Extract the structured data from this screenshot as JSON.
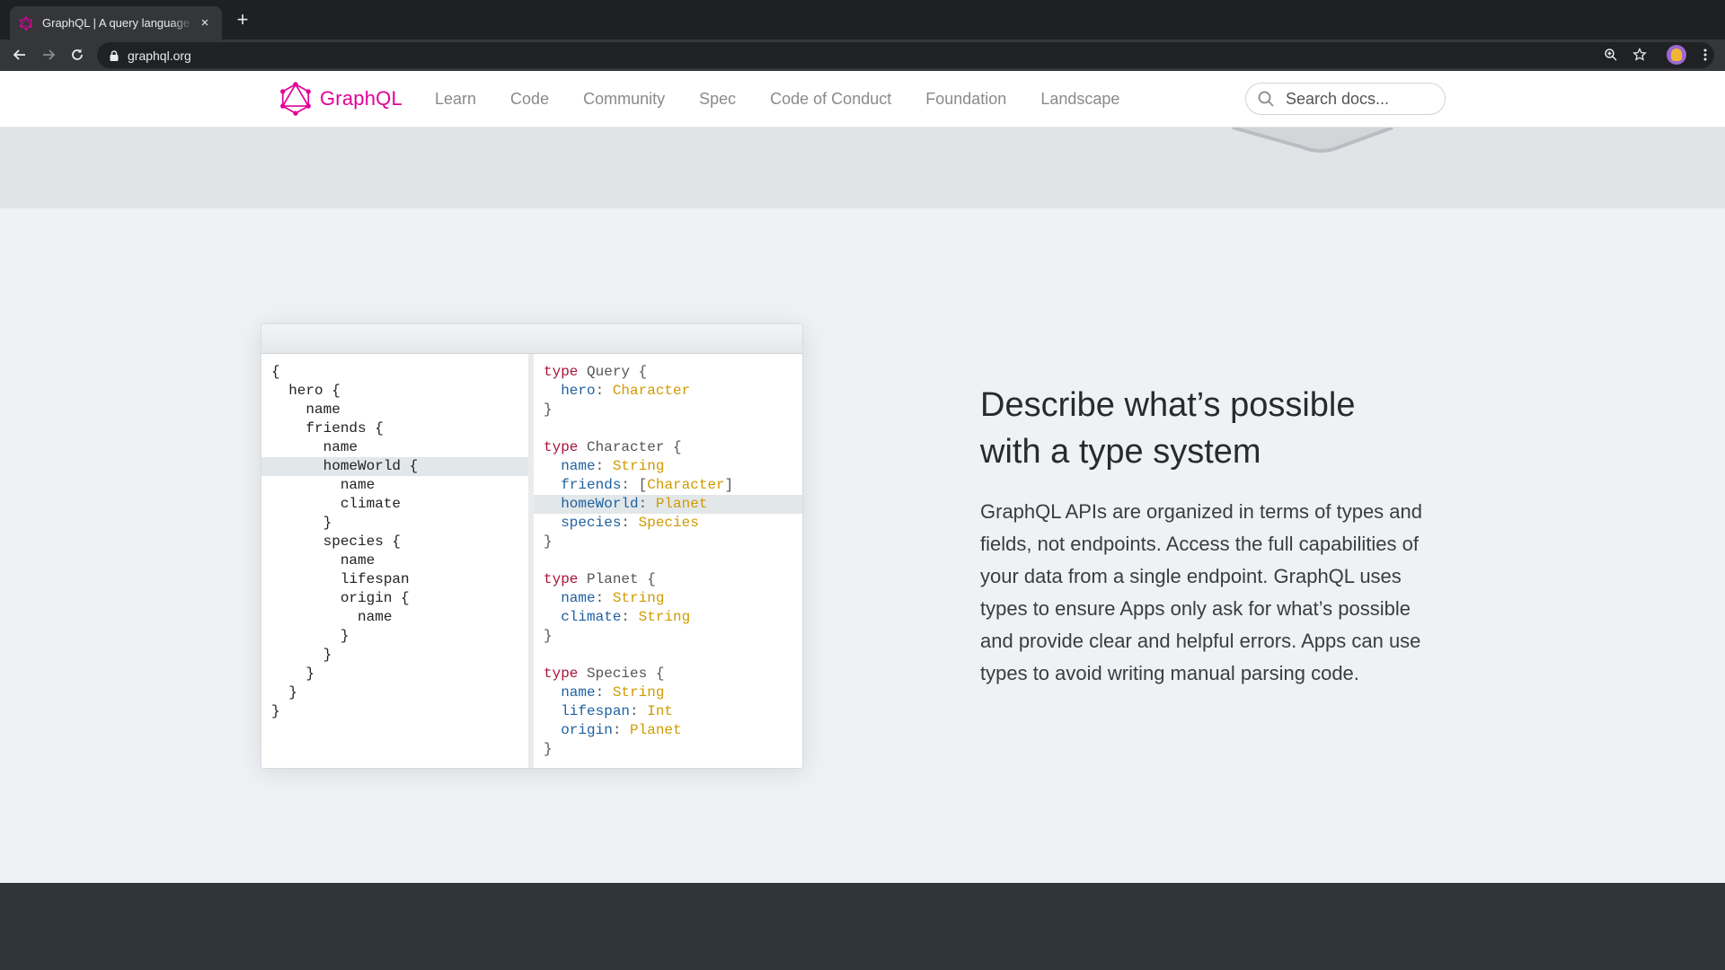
{
  "browser": {
    "tab_title": "GraphQL | A query language for your API",
    "tab_close": "×",
    "new_tab": "+",
    "url": "graphql.org"
  },
  "header": {
    "logo_text": "GraphQL",
    "nav": [
      "Learn",
      "Code",
      "Community",
      "Spec",
      "Code of Conduct",
      "Foundation",
      "Landscape"
    ],
    "search_placeholder": "Search docs..."
  },
  "section": {
    "headline_line1": "Describe what’s possible",
    "headline_line2": "with a type system",
    "body": "GraphQL APIs are organized in terms of types and fields, not endpoints. Access the full capabilities of your data from a single endpoint. GraphQL uses types to ensure Apps only ask for what’s possible and provide clear and helpful errors. Apps can use types to avoid writing manual parsing code."
  },
  "query_code": [
    "{",
    "  hero {",
    "    name",
    "    friends {",
    "      name",
    "      homeWorld {",
    "        name",
    "        climate",
    "      }",
    "      species {",
    "        name",
    "        lifespan",
    "        origin {",
    "          name",
    "        }",
    "      }",
    "    }",
    "  }",
    "}"
  ],
  "query_highlight_line": 5,
  "schema_code": [
    [
      [
        "kw",
        "type"
      ],
      [
        "br",
        " Query {"
      ]
    ],
    [
      [
        "br",
        "  "
      ],
      [
        "fld",
        "hero"
      ],
      [
        "br",
        ": "
      ],
      [
        "typ",
        "Character"
      ]
    ],
    [
      [
        "br",
        "}"
      ]
    ],
    [
      [
        "br",
        ""
      ]
    ],
    [
      [
        "kw",
        "type"
      ],
      [
        "br",
        " Character {"
      ]
    ],
    [
      [
        "br",
        "  "
      ],
      [
        "fld",
        "name"
      ],
      [
        "br",
        ": "
      ],
      [
        "typ",
        "String"
      ]
    ],
    [
      [
        "br",
        "  "
      ],
      [
        "fld",
        "friends"
      ],
      [
        "br",
        ": ["
      ],
      [
        "typ",
        "Character"
      ],
      [
        "br",
        "]"
      ]
    ],
    [
      [
        "br",
        "  "
      ],
      [
        "fld",
        "homeWorld"
      ],
      [
        "br",
        ": "
      ],
      [
        "typ",
        "Planet"
      ]
    ],
    [
      [
        "br",
        "  "
      ],
      [
        "fld",
        "species"
      ],
      [
        "br",
        ": "
      ],
      [
        "typ",
        "Species"
      ]
    ],
    [
      [
        "br",
        "}"
      ]
    ],
    [
      [
        "br",
        ""
      ]
    ],
    [
      [
        "kw",
        "type"
      ],
      [
        "br",
        " Planet {"
      ]
    ],
    [
      [
        "br",
        "  "
      ],
      [
        "fld",
        "name"
      ],
      [
        "br",
        ": "
      ],
      [
        "typ",
        "String"
      ]
    ],
    [
      [
        "br",
        "  "
      ],
      [
        "fld",
        "climate"
      ],
      [
        "br",
        ": "
      ],
      [
        "typ",
        "String"
      ]
    ],
    [
      [
        "br",
        "}"
      ]
    ],
    [
      [
        "br",
        ""
      ]
    ],
    [
      [
        "kw",
        "type"
      ],
      [
        "br",
        " Species {"
      ]
    ],
    [
      [
        "br",
        "  "
      ],
      [
        "fld",
        "name"
      ],
      [
        "br",
        ": "
      ],
      [
        "typ",
        "String"
      ]
    ],
    [
      [
        "br",
        "  "
      ],
      [
        "fld",
        "lifespan"
      ],
      [
        "br",
        ": "
      ],
      [
        "typ",
        "Int"
      ]
    ],
    [
      [
        "br",
        "  "
      ],
      [
        "fld",
        "origin"
      ],
      [
        "br",
        ": "
      ],
      [
        "typ",
        "Planet"
      ]
    ],
    [
      [
        "br",
        "}"
      ]
    ]
  ],
  "schema_highlight_line": 7,
  "colors": {
    "brand": "#e10098",
    "keyword": "#a7123c",
    "field": "#1f61a0",
    "type": "#d09a00",
    "highlight": "#e2e7ea"
  }
}
